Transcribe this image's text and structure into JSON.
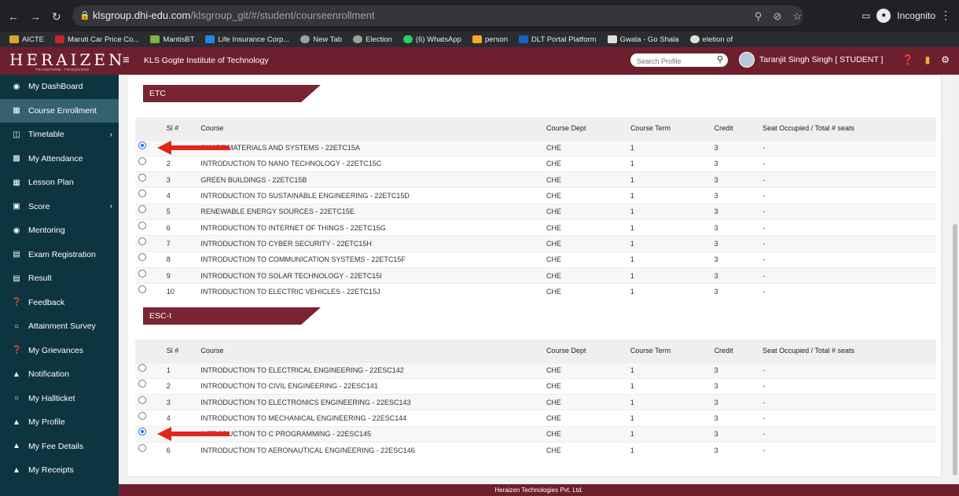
{
  "browser": {
    "url_host": "klsgroup.dhi-edu.com",
    "url_path": "/klsgroup_git/#/student/courseenrollment",
    "profile_label": "Incognito",
    "bookmarks": [
      "AICTE",
      "Maruti Car Price Co...",
      "MantisBT",
      "Life Insurance Corp...",
      "New Tab",
      "Election",
      "(6) WhatsApp",
      "person",
      "DLT Portal Platform",
      "Gwala - Go Shala",
      "eletion of"
    ]
  },
  "header": {
    "logo": "HERAIZEN",
    "logo_tagline": "TRANSFORM. TRANSCEND",
    "institute": "KLS Gogte Institute of Technology",
    "search_placeholder": "Search Profile",
    "user": "Taranjit Singh Singh [ STUDENT ]"
  },
  "sidebar": {
    "items": [
      {
        "label": "My DashBoard",
        "icon": "dashboard-icon"
      },
      {
        "label": "Course Enrollment",
        "icon": "enrollment-icon",
        "active": true
      },
      {
        "label": "Timetable",
        "icon": "calendar-icon",
        "has_submenu": true
      },
      {
        "label": "My Attendance",
        "icon": "chart-icon"
      },
      {
        "label": "Lesson Plan",
        "icon": "plan-icon"
      },
      {
        "label": "Score",
        "icon": "score-icon",
        "has_submenu": true
      },
      {
        "label": "Mentoring",
        "icon": "mentor-icon"
      },
      {
        "label": "Exam Registration",
        "icon": "exam-icon"
      },
      {
        "label": "Result",
        "icon": "result-icon"
      },
      {
        "label": "Feedback",
        "icon": "feedback-icon"
      },
      {
        "label": "Attainment Survey",
        "icon": "survey-icon"
      },
      {
        "label": "My Grievances",
        "icon": "grievance-icon"
      },
      {
        "label": "Notification",
        "icon": "bell-icon"
      },
      {
        "label": "My Hallticket",
        "icon": "ticket-icon"
      },
      {
        "label": "My Profile",
        "icon": "user-icon"
      },
      {
        "label": "My Fee Details",
        "icon": "user-icon"
      },
      {
        "label": "My Receipts",
        "icon": "user-icon"
      }
    ]
  },
  "columns": [
    "Sl #",
    "Course",
    "Course Dept",
    "Course Term",
    "Credit",
    "Seat Occupied / Total # seats"
  ],
  "sections": [
    {
      "title": "ETC",
      "rows": [
        {
          "sl": "1",
          "course": "SMART MATERIALS AND SYSTEMS - 22ETC15A",
          "dept": "CHE",
          "term": "1",
          "credit": "3",
          "seats": "-",
          "selected": true
        },
        {
          "sl": "2",
          "course": "INTRODUCTION TO NANO TECHNOLOGY - 22ETC15C",
          "dept": "CHE",
          "term": "1",
          "credit": "3",
          "seats": "-"
        },
        {
          "sl": "3",
          "course": "GREEN BUILDINGS - 22ETC15B",
          "dept": "CHE",
          "term": "1",
          "credit": "3",
          "seats": "-"
        },
        {
          "sl": "4",
          "course": "INTRODUCTION TO SUSTAINABLE ENGINEERING - 22ETC15D",
          "dept": "CHE",
          "term": "1",
          "credit": "3",
          "seats": "-"
        },
        {
          "sl": "5",
          "course": "RENEWABLE ENERGY SOURCES - 22ETC15E",
          "dept": "CHE",
          "term": "1",
          "credit": "3",
          "seats": "-"
        },
        {
          "sl": "6",
          "course": "INTRODUCTION TO INTERNET OF THINGS - 22ETC15G",
          "dept": "CHE",
          "term": "1",
          "credit": "3",
          "seats": "-"
        },
        {
          "sl": "7",
          "course": "INTRODUCTION TO CYBER SECURITY - 22ETC15H",
          "dept": "CHE",
          "term": "1",
          "credit": "3",
          "seats": "-"
        },
        {
          "sl": "8",
          "course": "INTRODUCTION TO COMMUNICATION SYSTEMS - 22ETC15F",
          "dept": "CHE",
          "term": "1",
          "credit": "3",
          "seats": "-"
        },
        {
          "sl": "9",
          "course": "INTRODUCTION TO SOLAR TECHNOLOGY - 22ETC15I",
          "dept": "CHE",
          "term": "1",
          "credit": "3",
          "seats": "-"
        },
        {
          "sl": "10",
          "course": "INTRODUCTION TO ELECTRIC VEHICLES - 22ETC15J",
          "dept": "CHE",
          "term": "1",
          "credit": "3",
          "seats": "-"
        }
      ]
    },
    {
      "title": "ESC-I",
      "rows": [
        {
          "sl": "1",
          "course": "INTRODUCTION TO ELECTRICAL ENGINEERING - 22ESC142",
          "dept": "CHE",
          "term": "1",
          "credit": "3",
          "seats": "-"
        },
        {
          "sl": "2",
          "course": "INTRODUCTION TO CIVIL ENGINEERING - 22ESC141",
          "dept": "CHE",
          "term": "1",
          "credit": "3",
          "seats": "-"
        },
        {
          "sl": "3",
          "course": "INTRODUCTION TO ELECTRONICS ENGINEERING - 22ESC143",
          "dept": "CHE",
          "term": "1",
          "credit": "3",
          "seats": "-"
        },
        {
          "sl": "4",
          "course": "INTRODUCTION TO MECHANICAL ENGINEERING - 22ESC144",
          "dept": "CHE",
          "term": "1",
          "credit": "3",
          "seats": "-"
        },
        {
          "sl": "5",
          "course": "INTRODUCTION TO C PROGRAMMING - 22ESC145",
          "dept": "CHE",
          "term": "1",
          "credit": "3",
          "seats": "-",
          "selected": true
        },
        {
          "sl": "6",
          "course": "INTRODUCTION TO AERONAUTICAL ENGINEERING - 22ESC146",
          "dept": "CHE",
          "term": "1",
          "credit": "3",
          "seats": "-"
        }
      ]
    }
  ],
  "footer": "Heraizen Technologies Pvt. Ltd.",
  "colors": {
    "brand": "#6e1f2d",
    "sidebar": "#0d3540",
    "sidebar_active": "#356171",
    "arrow": "#e1261c",
    "logo_accent": "#f2b233"
  }
}
